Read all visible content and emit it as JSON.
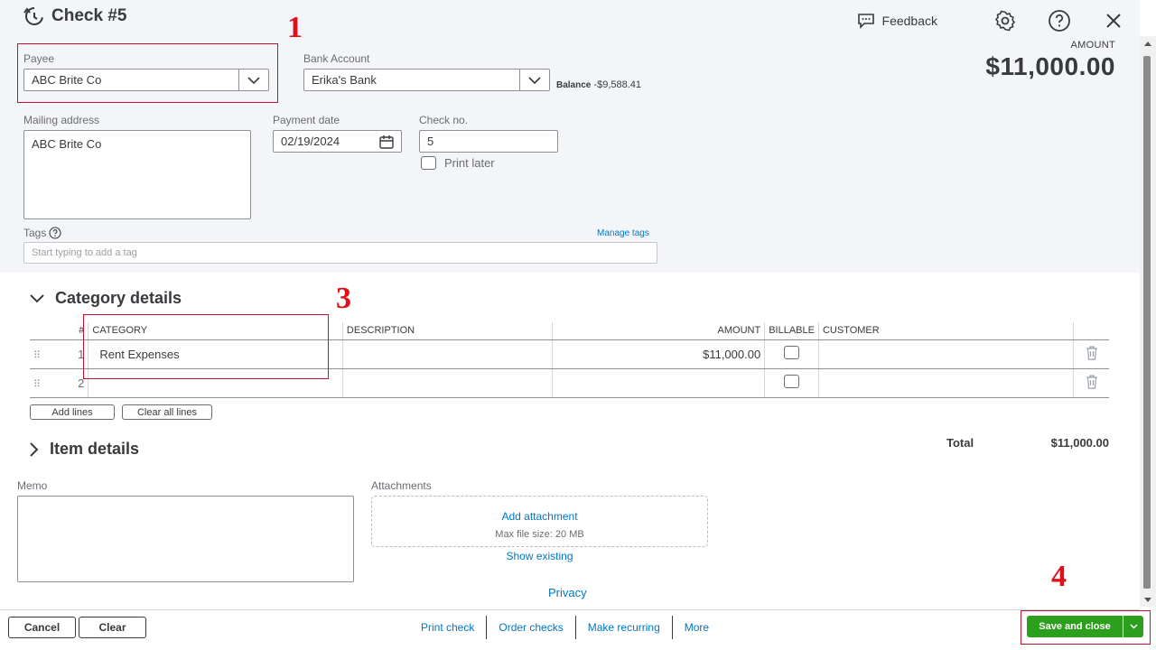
{
  "header": {
    "title": "Check #5",
    "feedback_label": "Feedback",
    "amount_label": "AMOUNT",
    "amount_value": "$11,000.00"
  },
  "form": {
    "payee_label": "Payee",
    "payee_value": "ABC Brite Co",
    "bank_label": "Bank Account",
    "bank_value": "Erika's Bank",
    "balance_label": "Balance",
    "balance_value": "-$9,588.41",
    "mailing_label": "Mailing address",
    "mailing_value": "ABC Brite Co",
    "date_label": "Payment date",
    "date_value": "02/19/2024",
    "checkno_label": "Check no.",
    "checkno_value": "5",
    "print_later_label": "Print later",
    "tags_label": "Tags",
    "manage_tags": "Manage tags",
    "tags_placeholder": "Start typing to add a tag"
  },
  "annotations": {
    "tag1": "1",
    "tag3": "3",
    "tag4": "4"
  },
  "category": {
    "heading": "Category details",
    "columns": {
      "num": "#",
      "category": "CATEGORY",
      "description": "DESCRIPTION",
      "amount": "AMOUNT",
      "billable": "BILLABLE",
      "customer": "CUSTOMER"
    },
    "rows": [
      {
        "num": "1",
        "category": "Rent Expenses",
        "description": "",
        "amount": "$11,000.00",
        "customer": ""
      },
      {
        "num": "2",
        "category": "",
        "description": "",
        "amount": "",
        "customer": ""
      }
    ],
    "add_lines": "Add lines",
    "clear_lines": "Clear all lines"
  },
  "item": {
    "heading": "Item details",
    "total_label": "Total",
    "total_value": "$11,000.00"
  },
  "memo": {
    "label": "Memo"
  },
  "attachments": {
    "label": "Attachments",
    "add": "Add attachment",
    "max_size": "Max file size: 20 MB",
    "show_existing": "Show existing"
  },
  "privacy": "Privacy",
  "footer": {
    "cancel": "Cancel",
    "clear": "Clear",
    "print_check": "Print check",
    "order_checks": "Order checks",
    "make_recurring": "Make recurring",
    "more": "More",
    "save_close": "Save and close"
  },
  "colors": {
    "accent_link": "#0077c5",
    "save_green": "#2ca01c",
    "annotation_red": "#e0101a"
  }
}
